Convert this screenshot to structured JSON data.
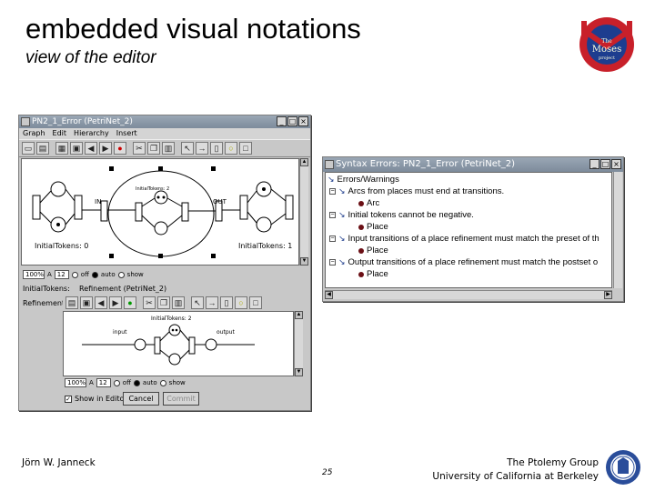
{
  "slide": {
    "title": "embedded visual notations",
    "subtitle": "view of the editor",
    "logo_text": [
      "The",
      "Moses",
      "project"
    ]
  },
  "editor_window": {
    "title": "PN2_1_Error (PetriNet_2)",
    "menu": [
      "Graph",
      "Edit",
      "Hierarchy",
      "Insert"
    ],
    "canvas_labels": {
      "initial_tokens_left": "InitialTokens: 0",
      "initial_tokens_center": "InitialTokens: 2",
      "initial_tokens_right": "InitialTokens: 1",
      "in_label": "IN",
      "out_label": "OUT",
      "inner_input": "input",
      "inner_output": "output"
    },
    "zoom_value": "100%",
    "font_size_value": "12",
    "radio_options": [
      "off",
      "auto",
      "show"
    ],
    "selected_radio": "auto"
  },
  "inner_panel": {
    "initial_tokens_label": "InitialTokens:",
    "refinement_header": "Refinement (PetriNet_2)",
    "refinement_label": "Refinement:",
    "canvas_labels": {
      "initial_tokens": "InitialTokens: 2",
      "input": "input",
      "output": "output"
    },
    "zoom_value": "100%",
    "font_size_value": "12",
    "radio_options": [
      "off",
      "auto",
      "show"
    ],
    "show_in_editor_label": "Show in Editor",
    "show_in_editor_checked": true,
    "cancel_label": "Cancel",
    "commit_label": "Commit"
  },
  "syntax_window": {
    "title": "Syntax Errors: PN2_1_Error (PetriNet_2)",
    "root": "Errors/Warnings",
    "errors": [
      {
        "message": "Arcs from places must end at transitions.",
        "child": "Arc"
      },
      {
        "message": "Initial tokens cannot be negative.",
        "child": "Place"
      },
      {
        "message": "Input transitions of a place refinement must match the preset of th",
        "child": "Place"
      },
      {
        "message": "Output transitions of a place refinement must match the postset o",
        "child": "Place"
      }
    ]
  },
  "footer": {
    "author": "Jörn W. Janneck",
    "page_number": "25",
    "group_line1": "The Ptolemy Group",
    "group_line2": "University of California at Berkeley"
  },
  "colors": {
    "titlebar": "#7d8b9b",
    "logo_red": "#c8202a",
    "logo_blue": "#1d3d8f",
    "error_dot": "#6b0f15",
    "seal_blue": "#2a4d9a"
  }
}
